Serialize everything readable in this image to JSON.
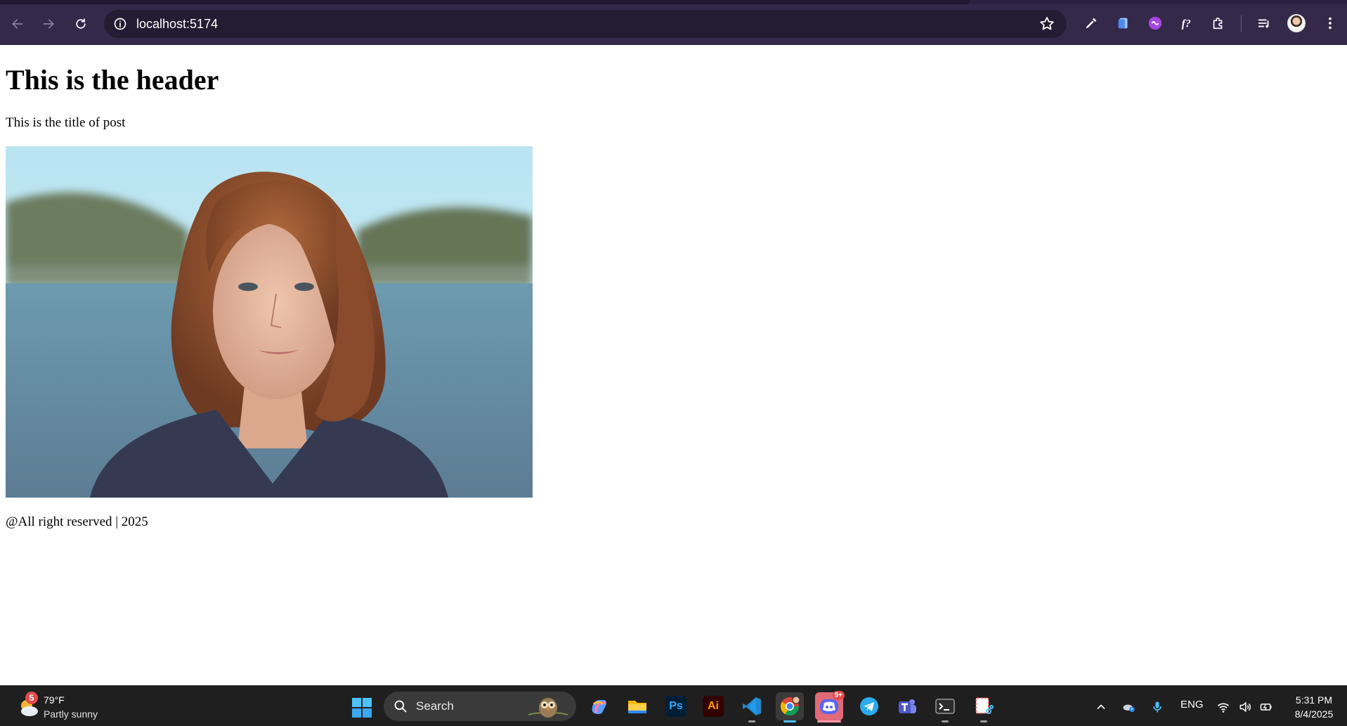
{
  "browser": {
    "url": "localhost:5174",
    "icons": [
      "back-arrow-icon",
      "forward-arrow-icon",
      "reload-icon",
      "site-info-icon",
      "bookmark-star-icon",
      "eyedropper-extension-icon",
      "docs-extension-icon",
      "purple-extension-icon",
      "font-finder-extension-icon",
      "extensions-puzzle-icon",
      "reading-list-icon",
      "profile-avatar",
      "menu-kebab-icon"
    ]
  },
  "page": {
    "header": "This is the header",
    "post_title": "This is the title of post",
    "footer": "@All right reserved | 2025"
  },
  "taskbar": {
    "weather": {
      "badge": "5",
      "temperature": "79°F",
      "condition": "Partly sunny"
    },
    "search_label": "Search",
    "apps": [
      {
        "name": "copilot",
        "label": ""
      },
      {
        "name": "file-explorer",
        "label": ""
      },
      {
        "name": "photoshop",
        "label": "Ps"
      },
      {
        "name": "illustrator",
        "label": "Ai"
      },
      {
        "name": "vscode",
        "label": ""
      },
      {
        "name": "chrome",
        "label": ""
      },
      {
        "name": "discord",
        "label": "",
        "badge": "9+"
      },
      {
        "name": "telegram",
        "label": ""
      },
      {
        "name": "teams",
        "label": ""
      },
      {
        "name": "terminal",
        "label": ""
      },
      {
        "name": "snipping-tool",
        "label": ""
      }
    ],
    "language": "ENG",
    "time": "5:31 PM",
    "date": "8/4/2025"
  },
  "colors": {
    "chrome_bg": "#35294a",
    "omnibox_bg": "#241c33",
    "taskbar_bg": "#1f1f1f",
    "page_bg": "#ffffff"
  }
}
